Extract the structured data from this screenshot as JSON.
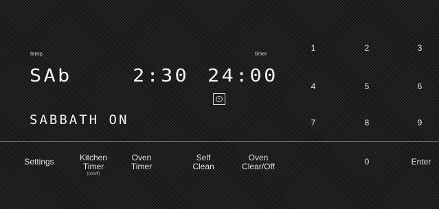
{
  "display": {
    "temp_label": "temp",
    "timer_label": "timer",
    "temp_value": "SAb",
    "clock_value": "2:30",
    "timer_value": "24:00",
    "status_message": "SABBATH ON",
    "icon": "oven-mode-icon"
  },
  "keypad": {
    "digits": [
      "1",
      "2",
      "3",
      "4",
      "5",
      "6",
      "7",
      "8",
      "9",
      "0"
    ],
    "enter": "Enter"
  },
  "controls": {
    "settings": "Settings",
    "kitchen_timer": "Kitchen\nTimer",
    "kitchen_timer_sub": "(on/off)",
    "oven_timer": "Oven\nTimer",
    "self_clean": "Self\nClean",
    "oven_clear_off": "Oven\nClear/Off"
  }
}
